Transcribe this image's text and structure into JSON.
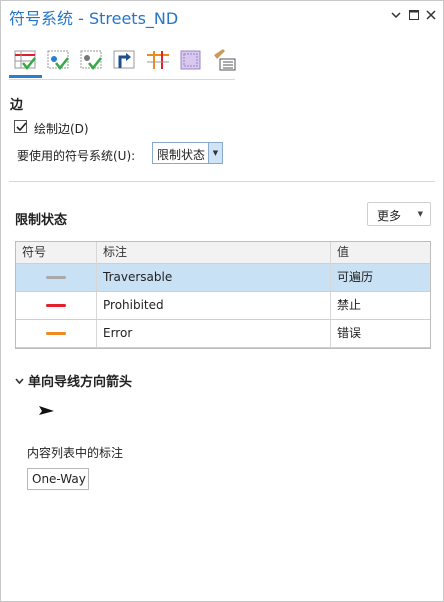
{
  "pane": {
    "title": "符号系统 - Streets_ND",
    "window_buttons": [
      "chevron-down-icon",
      "maximize-icon",
      "close-icon"
    ]
  },
  "toolbar": {
    "tools": [
      {
        "name": "tool-edges",
        "icon": "edge-symbology-icon",
        "active": true
      },
      {
        "name": "tool-junctions",
        "icon": "junction-symbology-icon"
      },
      {
        "name": "tool-system-junctions",
        "icon": "system-junction-icon"
      },
      {
        "name": "tool-turns",
        "icon": "turn-icon"
      },
      {
        "name": "tool-restrictions",
        "icon": "restriction-grid-icon"
      },
      {
        "name": "tool-polygon",
        "icon": "polygon-icon"
      },
      {
        "name": "tool-properties",
        "icon": "brush-list-icon"
      }
    ]
  },
  "edges": {
    "heading": "边",
    "draw_edges_label": "绘制边(D)",
    "draw_edges_checked": true,
    "symbology_label": "要使用的符号系统(U):",
    "symbology_value": "限制状态"
  },
  "restriction": {
    "heading": "限制状态",
    "more_label": "更多",
    "columns": [
      "符号",
      "标注",
      "值"
    ],
    "rows": [
      {
        "label": "Traversable",
        "value": "可遍历",
        "color": "#a9a9a9",
        "selected": true
      },
      {
        "label": "Prohibited",
        "value": "禁止",
        "color": "#e0202a",
        "selected": false
      },
      {
        "label": "Error",
        "value": "错误",
        "color": "#f08a1e",
        "selected": false
      }
    ]
  },
  "oneway": {
    "heading": "单向导线方向箭头",
    "content_label": "内容列表中的标注",
    "content_value": "One-Way"
  },
  "colors": {
    "accent": "#2576c9",
    "selected_row": "#c9e1f5"
  }
}
